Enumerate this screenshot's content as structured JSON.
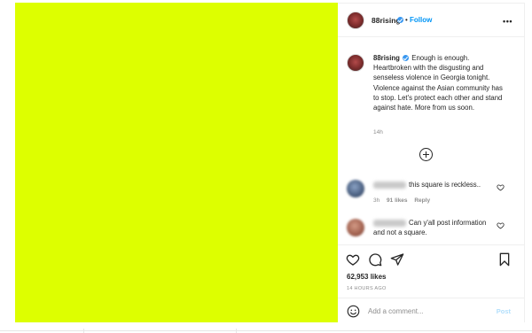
{
  "post": {
    "image_color": "#ddff00",
    "account": {
      "username": "88rising",
      "verified": true,
      "follow_label": "Follow",
      "separator": "•"
    },
    "caption": {
      "username": "88rising",
      "text": "Enough is enough. Heartbroken with the disgusting and senseless violence in Georgia tonight. Violence against the Asian community has to stop. Let's protect each other and stand against hate. More from us soon.",
      "time": "14h"
    },
    "comments": [
      {
        "text": "this square is reckless..",
        "time": "3h",
        "likes": "91 likes",
        "reply_label": "Reply"
      },
      {
        "text": "Can y'all post information and not a square.",
        "time": "",
        "likes": "",
        "reply_label": ""
      }
    ],
    "likes_count": "62,953 likes",
    "date": "14 HOURS AGO",
    "add_comment": {
      "placeholder": "Add a comment...",
      "post_label": "Post"
    },
    "icons": {
      "more": "more-options-icon",
      "load_more": "plus-circle-icon",
      "like": "heart-icon",
      "comment": "comment-icon",
      "share": "send-icon",
      "save": "bookmark-icon",
      "emoji": "emoji-icon"
    },
    "colors": {
      "link_blue": "#0095f6",
      "verified_blue": "#3897f0",
      "muted_text": "#8e8e8e"
    }
  }
}
